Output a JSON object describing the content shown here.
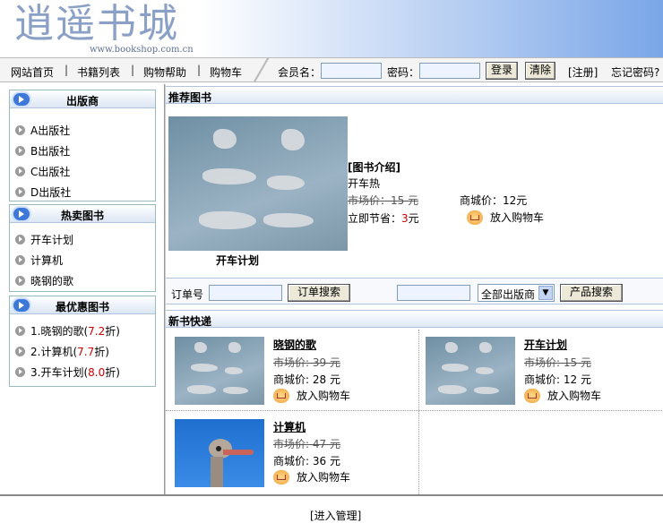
{
  "header": {
    "logo": "逍遥书城",
    "url": "www.bookshop.com.cn"
  },
  "nav": {
    "items": [
      "网站首页",
      "书籍列表",
      "购物帮助",
      "购物车"
    ],
    "member_label": "会员名：",
    "password_label": "密码：",
    "login": "登录",
    "clear": "清除",
    "register": "[注册]",
    "forgot": "忘记密码?"
  },
  "sidebar": {
    "publishers": {
      "title": "出版商",
      "items": [
        "A出版社",
        "B出版社",
        "C出版社",
        "D出版社"
      ]
    },
    "hot": {
      "title": "热卖图书",
      "items": [
        "开车计划",
        "计算机",
        "晓钢的歌"
      ]
    },
    "discount": {
      "title": "最优惠图书",
      "items": [
        {
          "prefix": "1.晓钢的歌(",
          "value": "7.2",
          "suffix": "折)"
        },
        {
          "prefix": "2.计算机(",
          "value": "7.7",
          "suffix": "折)"
        },
        {
          "prefix": "3.开车计划(",
          "value": "8.0",
          "suffix": "折)"
        }
      ]
    }
  },
  "recommend": {
    "title": "推荐图书",
    "book_name": "开车计划",
    "intro_title": "[图书介绍]",
    "intro_text": "开车热",
    "market_price": "市场价：15 元",
    "mall_price": "商城价：12元",
    "save_prefix": "立即节省：",
    "save_value": "3",
    "save_suffix": "元",
    "cart": "放入购物车"
  },
  "search": {
    "order_label": "订单号",
    "order_button": "订单搜索",
    "publisher_select": "全部出版商",
    "product_button": "产品搜索"
  },
  "newbooks": {
    "title": "新书快递",
    "books": [
      {
        "name": "晓钢的歌",
        "market": "市场价: 39 元",
        "mall": "商城价: 28 元",
        "cart": "放入购物车"
      },
      {
        "name": "开车计划",
        "market": "市场价: 15 元",
        "mall": "商城价: 12 元",
        "cart": "放入购物车"
      },
      {
        "name": "计算机",
        "market": "市场价: 47 元",
        "mall": "商城价: 36 元",
        "cart": "放入购物车"
      }
    ]
  },
  "footer": {
    "admin": "[进入管理]"
  }
}
